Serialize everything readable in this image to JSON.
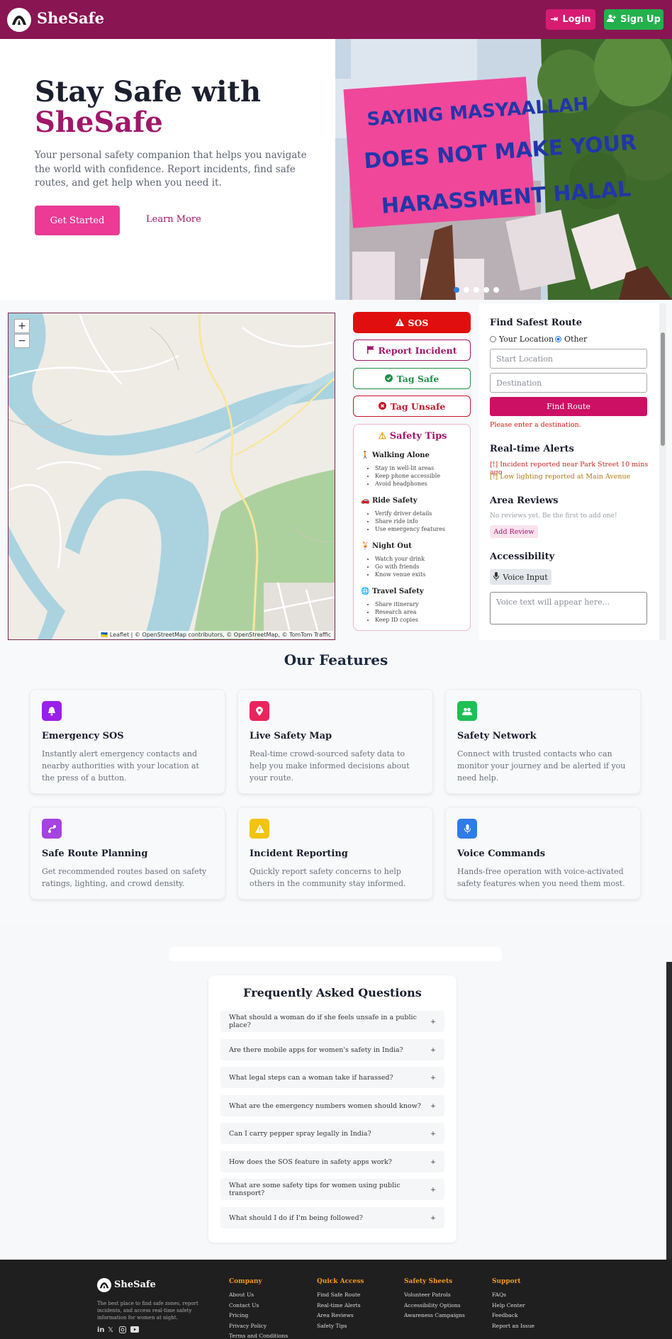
{
  "header": {
    "brand": "SheSafe",
    "login": "Login",
    "signup": "Sign Up"
  },
  "hero": {
    "title_line1": "Stay Safe with",
    "title_line2": "SheSafe",
    "description": "Your personal safety companion that helps you navigate the world with confidence. Report incidents, find safe routes, and get help when you need it.",
    "get_started": "Get Started",
    "learn_more": "Learn More",
    "carousel_dots": 5,
    "carousel_active": 0
  },
  "map": {
    "zoom_in": "+",
    "zoom_out": "−",
    "attribution": "🇺🇦 Leaflet | © OpenStreetMap contributors, © OpenStreetMap, © TomTom Traffic"
  },
  "actions": {
    "sos": "SOS",
    "report": "Report Incident",
    "tag_safe": "Tag Safe",
    "tag_unsafe": "Tag Unsafe"
  },
  "safety_tips": {
    "title": "Safety Tips",
    "sections": [
      {
        "icon": "walking-icon",
        "title": "Walking Alone",
        "items": [
          "Stay in well-lit areas",
          "Keep phone accessible",
          "Avoid headphones"
        ]
      },
      {
        "icon": "car-icon",
        "title": "Ride Safety",
        "items": [
          "Verify driver details",
          "Share ride info",
          "Use emergency features"
        ]
      },
      {
        "icon": "glass-icon",
        "title": "Night Out",
        "items": [
          "Watch your drink",
          "Go with friends",
          "Know venue exits"
        ]
      },
      {
        "icon": "globe-icon",
        "title": "Travel Safety",
        "items": [
          "Share itinerary",
          "Research area",
          "Keep ID copies"
        ]
      }
    ]
  },
  "route": {
    "title": "Find Safest Route",
    "radio_current": "Your Location",
    "radio_other": "Other",
    "selected": "Other",
    "start_placeholder": "Start Location",
    "dest_placeholder": "Destination",
    "button": "Find Route",
    "error": "Please enter a destination."
  },
  "alerts": {
    "title": "Real-time Alerts",
    "items": [
      {
        "text": "[!] Incident reported near Park Street 10 mins ago",
        "color": "#c62828"
      },
      {
        "text": "[!] Low lighting reported at Main Avenue",
        "color": "#b07a10"
      }
    ]
  },
  "reviews": {
    "title": "Area Reviews",
    "empty": "No reviews yet. Be the first to add one!",
    "add": "Add Review"
  },
  "accessibility": {
    "title": "Accessibility",
    "voice_button": "Voice Input",
    "voice_placeholder": "Voice text will appear here..."
  },
  "features": {
    "title": "Our Features",
    "items": [
      {
        "title": "Emergency SOS",
        "desc": "Instantly alert emergency contacts and nearby authorities with your location at the press of a button.",
        "icon": "bell-icon",
        "color": "#9b1fe8"
      },
      {
        "title": "Live Safety Map",
        "desc": "Real-time crowd-sourced safety data to help you make informed decisions about your route.",
        "icon": "map-pin-icon",
        "color": "#e8265e"
      },
      {
        "title": "Safety Network",
        "desc": "Connect with trusted contacts who can monitor your journey and be alerted if you need help.",
        "icon": "users-icon",
        "color": "#1fbf55"
      },
      {
        "title": "Safe Route Planning",
        "desc": "Get recommended routes based on safety ratings, lighting, and crowd density.",
        "icon": "route-icon",
        "color": "#a542e0"
      },
      {
        "title": "Incident Reporting",
        "desc": "Quickly report safety concerns to help others in the community stay informed.",
        "icon": "warning-icon",
        "color": "#f2c30f"
      },
      {
        "title": "Voice Commands",
        "desc": "Hands-free operation with voice-activated safety features when you need them most.",
        "icon": "microphone-icon",
        "color": "#2f7be8"
      }
    ]
  },
  "faq": {
    "title": "Frequently Asked Questions",
    "items": [
      "What should a woman do if she feels unsafe in a public place?",
      "Are there mobile apps for women's safety in India?",
      "What legal steps can a woman take if harassed?",
      "What are the emergency numbers women should know?",
      "Can I carry pepper spray legally in India?",
      "How does the SOS feature in safety apps work?",
      "What are some safety tips for women using public transport?",
      "What should I do if I'm being followed?"
    ],
    "toggle": "+"
  },
  "footer": {
    "brand": "SheSafe",
    "desc": "The best place to find safe zones, report incidents, and access real-time safety information for women at night.",
    "columns": [
      {
        "title": "Company",
        "links": [
          "About Us",
          "Contact Us",
          "Pricing",
          "Privacy Policy",
          "Terms and Conditions"
        ]
      },
      {
        "title": "Quick Access",
        "links": [
          "Find Safe Route",
          "Real-time Alerts",
          "Area Reviews",
          "Safety Tips"
        ]
      },
      {
        "title": "Safety Sheets",
        "links": [
          "Volunteer Patrols",
          "Accessibility Options",
          "Awareness Campaigns"
        ]
      },
      {
        "title": "Support",
        "links": [
          "FAQs",
          "Help Center",
          "Feedback",
          "Report an Issue"
        ]
      }
    ],
    "social": [
      "linkedin-icon",
      "x-icon",
      "instagram-icon",
      "youtube-icon"
    ]
  },
  "colors": {
    "brand": "#8a1553",
    "accent": "#ec3a95",
    "sos": "#e00e0e",
    "success": "#22b14c"
  }
}
